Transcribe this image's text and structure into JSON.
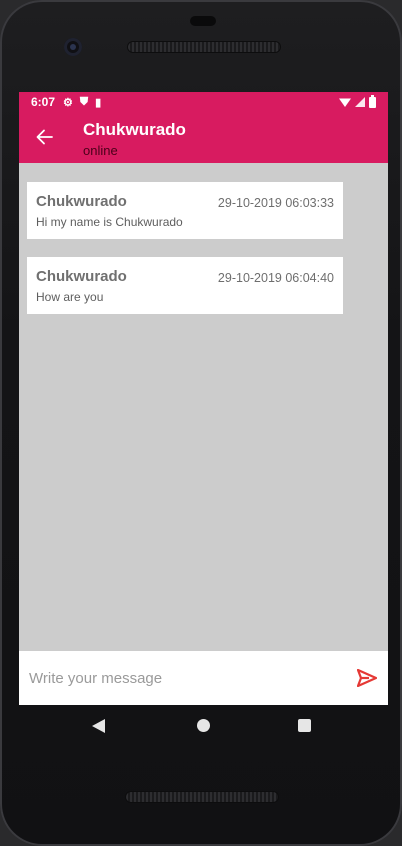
{
  "status_bar": {
    "time": "6:07",
    "icons_left": [
      "gear-icon",
      "shield-icon",
      "sd-card-icon"
    ],
    "icons_right": [
      "wifi-icon",
      "signal-icon",
      "battery-icon"
    ]
  },
  "toolbar": {
    "title": "Chukwurado",
    "subtitle": "online",
    "color": "#d81b60"
  },
  "messages": [
    {
      "sender": "Chukwurado",
      "timestamp": "29-10-2019 06:03:33",
      "text": "Hi my name is Chukwurado"
    },
    {
      "sender": "Chukwurado",
      "timestamp": "29-10-2019 06:04:40",
      "text": "How are you"
    }
  ],
  "composer": {
    "placeholder": "Write your message",
    "value": "",
    "send_icon": "send-icon",
    "send_color": "#e53935"
  },
  "nav_bar": {
    "buttons": [
      "back-icon",
      "home-icon",
      "recents-icon"
    ]
  }
}
